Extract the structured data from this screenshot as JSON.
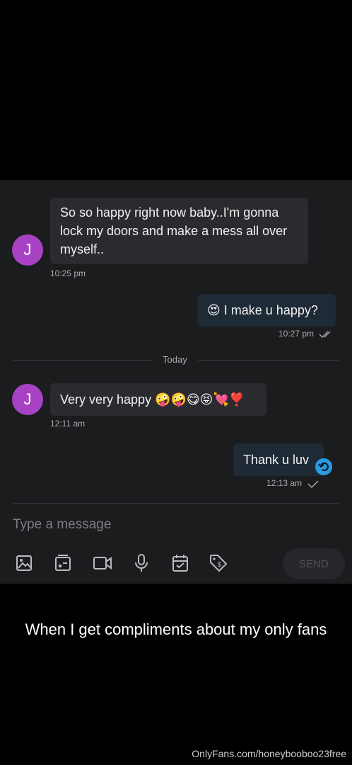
{
  "messages": [
    {
      "text": "So so happy right now baby..I'm gonna lock my doors and make a mess all over myself..",
      "time": "10:25 pm",
      "avatar_letter": "J"
    },
    {
      "text": "I make u happy?",
      "emoji": "😍",
      "time": "10:27 pm"
    },
    {
      "text": "Very very happy",
      "emoji": "🤪🤪😋😝💘❣️",
      "time": "12:11 am",
      "avatar_letter": "J"
    },
    {
      "text": "Thank u luv",
      "time": "12:13 am"
    }
  ],
  "divider": {
    "label": "Today"
  },
  "composer": {
    "placeholder": "Type a message",
    "send_label": "SEND"
  },
  "toolbar_icons": [
    "image-icon",
    "gallery-icon",
    "video-camera-icon",
    "microphone-icon",
    "calendar-check-icon",
    "price-tag-icon"
  ],
  "caption": "When I get compliments about my only fans",
  "watermark": "OnlyFans.com/honeybooboo23free",
  "colors": {
    "avatar": "#a742c4",
    "incoming_bubble": "#2a2b2e",
    "outgoing_bubble": "#1e2a35",
    "chat_background": "#1b1c1e",
    "reply_badge": "#2a9ce0"
  }
}
